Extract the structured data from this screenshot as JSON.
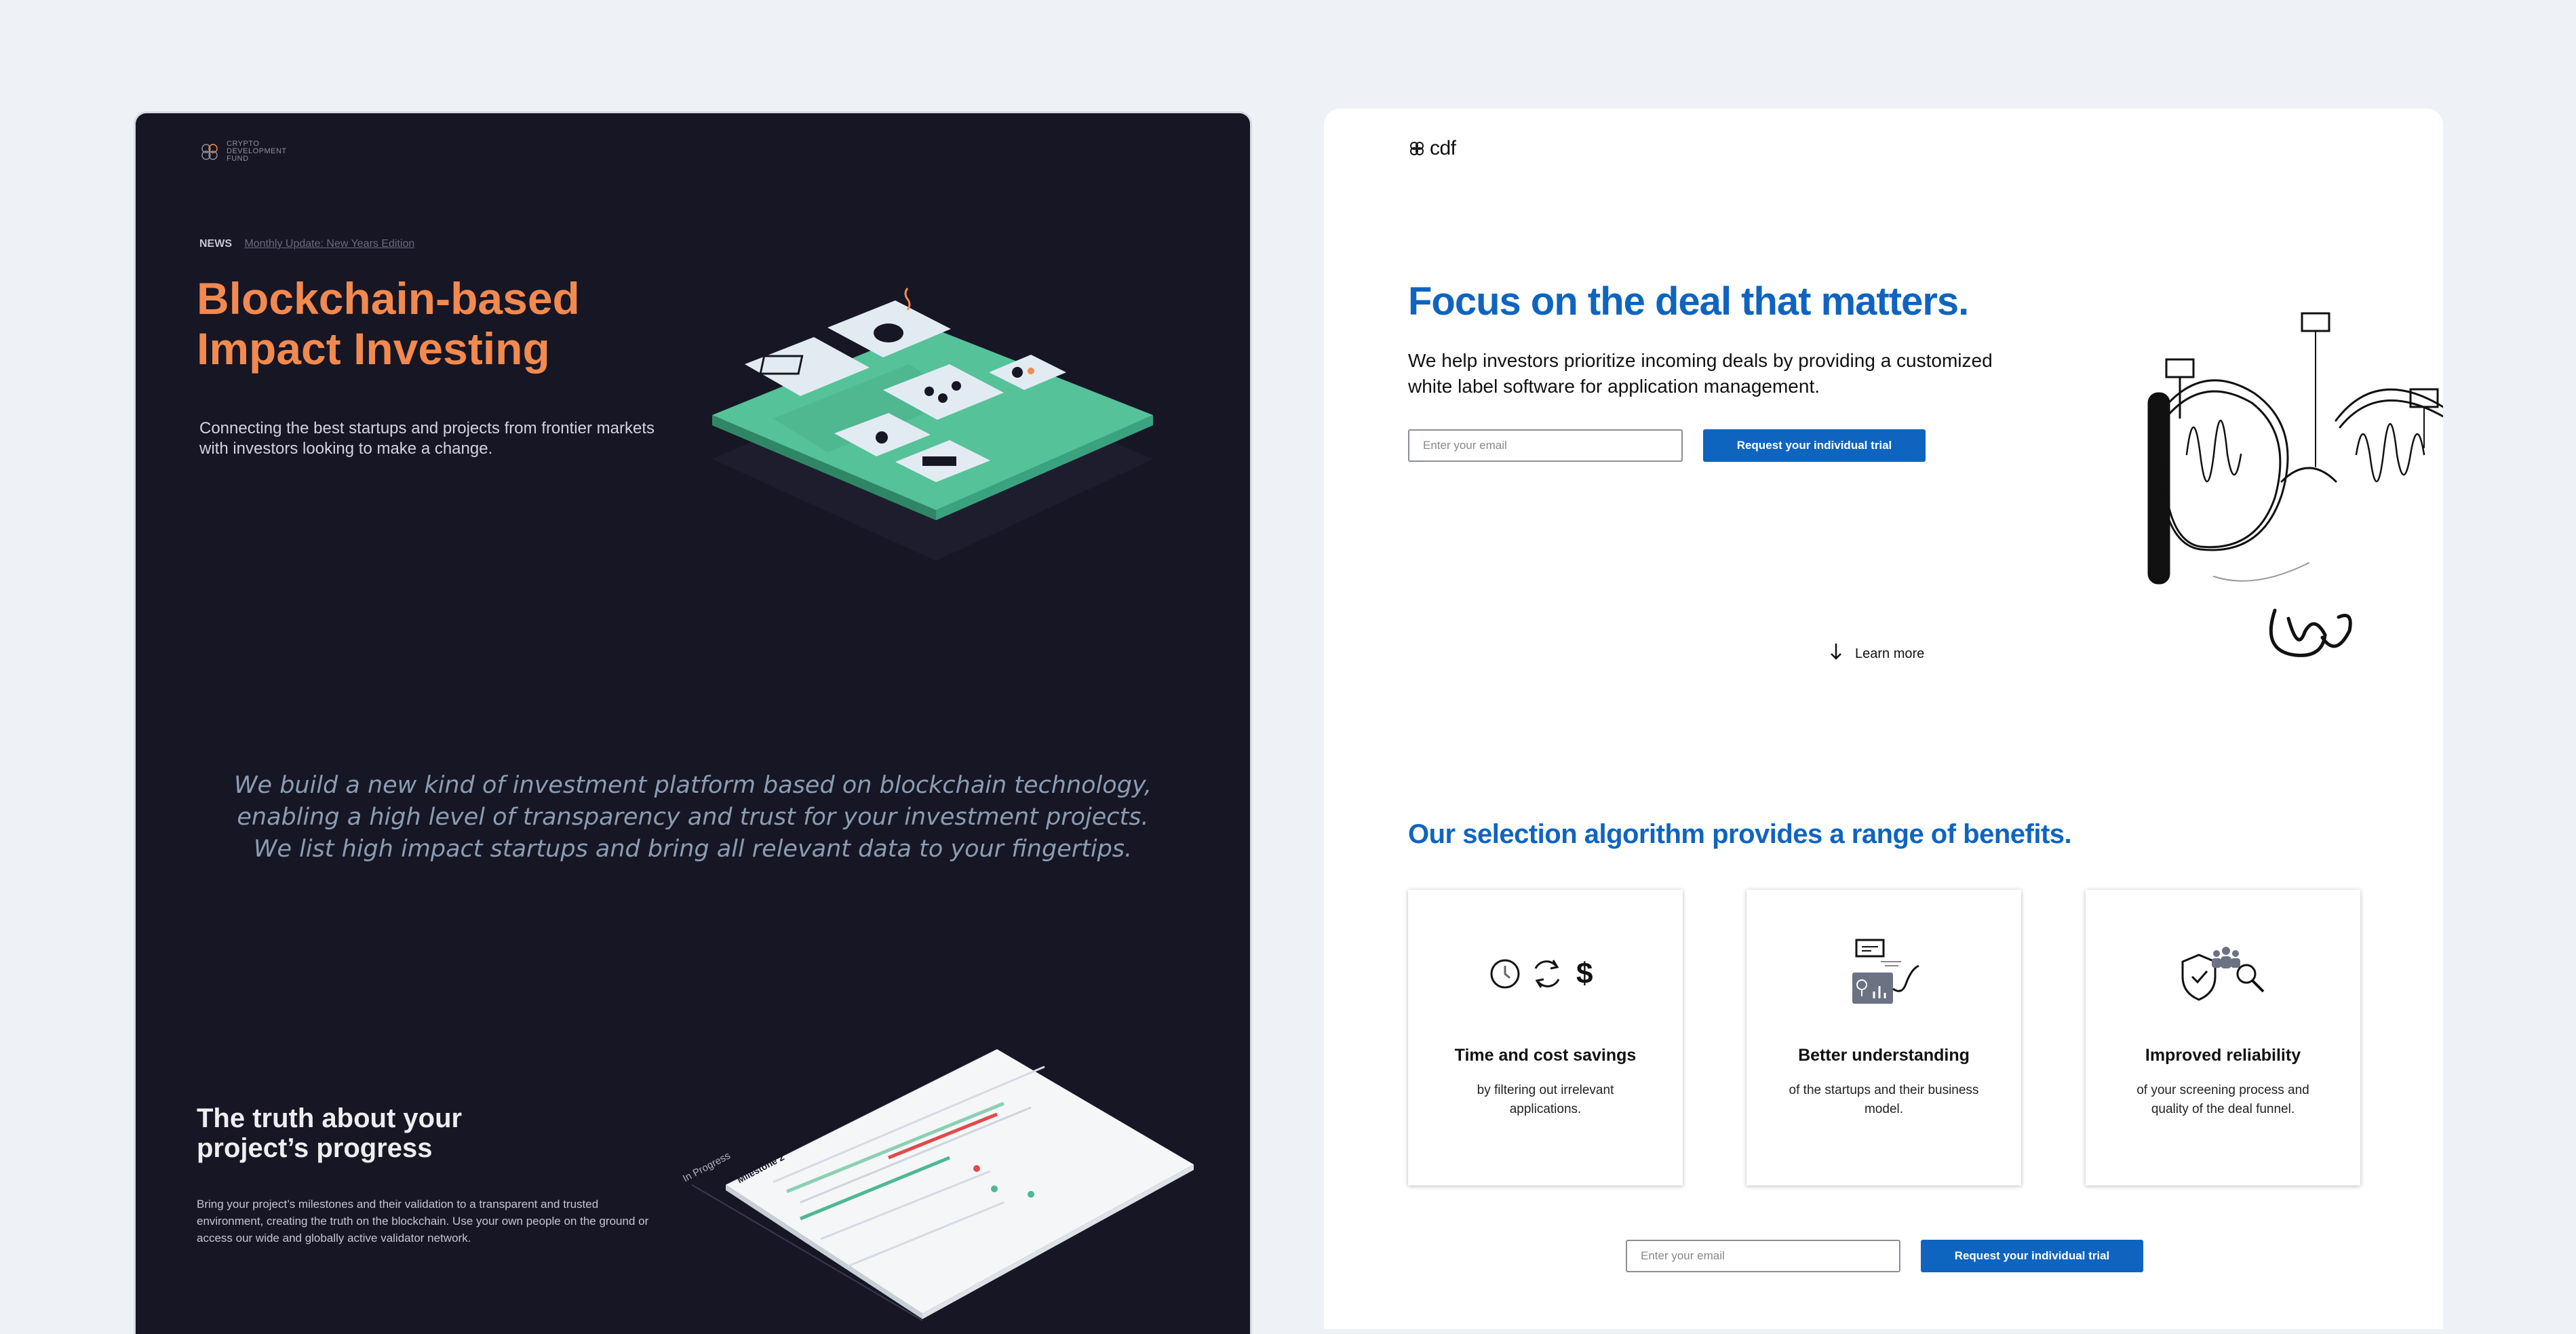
{
  "left": {
    "logo_text": "Crypto Development Fund",
    "news_tag": "NEWS",
    "news_link": "Monthly Update: New Years Edition",
    "title_line1": "Blockchain-based",
    "title_line2": "Impact Investing",
    "subtitle": "Connecting the best startups and projects from frontier markets with investors looking to make a change.",
    "quote": "We build a new kind of investment platform based on blockchain technology, enabling a high level of transparency and trust  for your investment projects. We list high impact startups and bring all relevant data to your fingertips.",
    "section_title_line1": "The truth about your",
    "section_title_line2": "project’s  progress",
    "section_body": "Bring your project’s milestones and their validation to a transparent and trusted environment, creating the truth on the blockchain. Use your own people on the ground or access our wide and globally active validator network.",
    "mock_status": "In Progress",
    "mock_title": "Milestone 2",
    "colors": {
      "background": "#171625",
      "accent": "#f2894e",
      "green": "#4fb892"
    }
  },
  "right": {
    "logo_text": "cdf",
    "hero_title": "Focus on the deal that matters.",
    "hero_subtitle": "We help investors prioritize incoming deals by providing a customized white label software for application management.",
    "email_placeholder": "Enter your email",
    "cta_label": "Request your individual trial",
    "learn_more": "Learn more",
    "benefits_title": "Our selection algorithm provides a range of benefits.",
    "cards": [
      {
        "title": "Time and cost savings",
        "description": "by filtering out irrelevant applications.",
        "icons": [
          "clock-icon",
          "refresh-icon",
          "dollar-icon"
        ]
      },
      {
        "title": "Better understanding",
        "description": "of the startups and their business model.",
        "icons": [
          "analytics-icon"
        ]
      },
      {
        "title": "Improved reliability",
        "description": "of your screening process and quality of the deal funnel.",
        "icons": [
          "shield-check-icon",
          "team-icon",
          "magnifier-icon"
        ]
      }
    ],
    "colors": {
      "primary": "#0f64c0",
      "text": "#111111"
    }
  }
}
